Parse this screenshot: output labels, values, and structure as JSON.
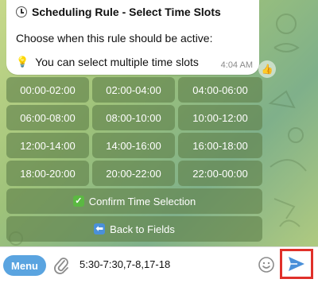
{
  "message": {
    "title": "Scheduling Rule - Select Time Slots",
    "description": "Choose when this rule should be active:",
    "hint": "You can select multiple time slots",
    "time": "4:04 AM"
  },
  "keyboard": {
    "time_slots": [
      "00:00-02:00",
      "02:00-04:00",
      "04:00-06:00",
      "06:00-08:00",
      "08:00-10:00",
      "10:00-12:00",
      "12:00-14:00",
      "14:00-16:00",
      "16:00-18:00",
      "18:00-20:00",
      "20:00-22:00",
      "22:00-00:00"
    ],
    "confirm_label": "Confirm Time Selection",
    "back_label": "Back to Fields"
  },
  "composer": {
    "menu_label": "Menu",
    "input_value": "5:30-7:30,7-8,17-18"
  },
  "colors": {
    "menu_button": "#5aa4e0",
    "send_icon": "#4a90d9",
    "highlight_frame": "#e0302a",
    "keyboard_button": "#60804a"
  }
}
